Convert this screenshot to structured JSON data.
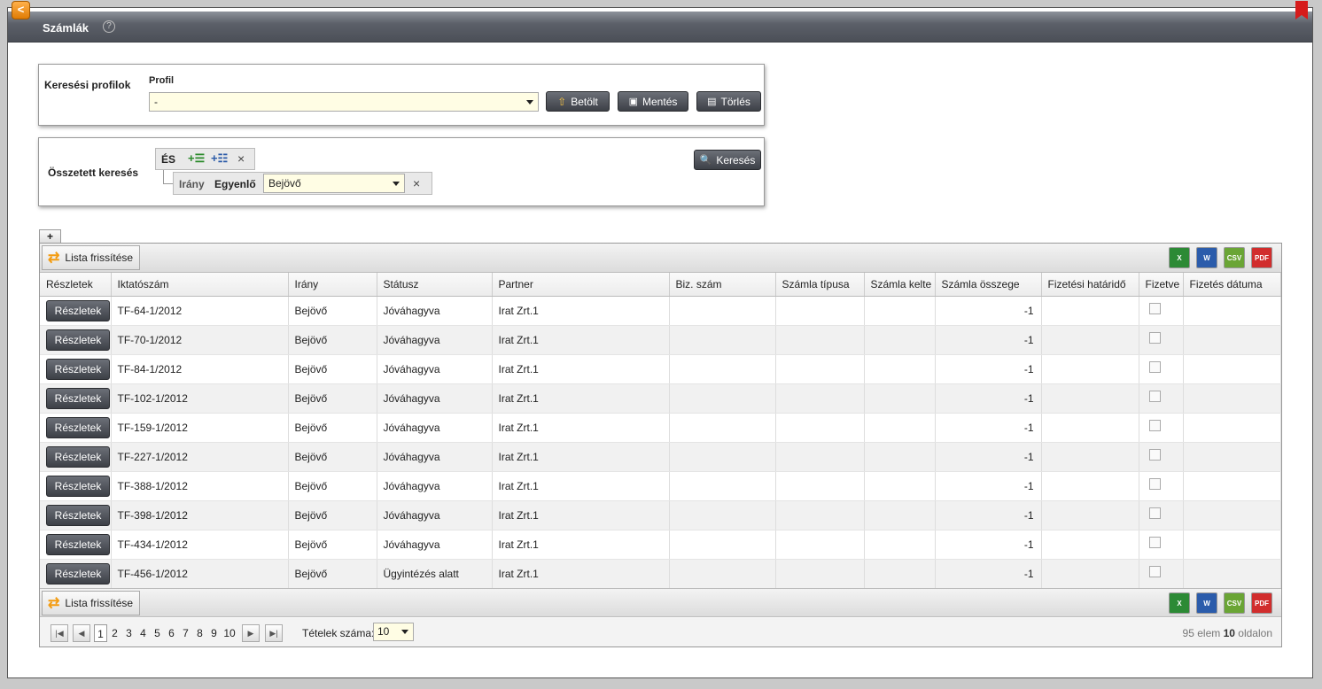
{
  "window": {
    "title": "Számlák",
    "help_icon": "?",
    "back_icon": "<"
  },
  "profiles": {
    "section_label": "Keresési profilok",
    "profile_label": "Profil",
    "profile_value": "-",
    "load_label": "Betölt",
    "save_label": "Mentés",
    "delete_label": "Törlés"
  },
  "complex_search": {
    "section_label": "Összetett keresés",
    "and_label": "ÉS",
    "remove_icon": "×",
    "field_label": "Irány",
    "operator_label": "Egyenlő",
    "value": "Bejövő",
    "search_label": "Keresés"
  },
  "add_tab": "+",
  "toolbar": {
    "refresh_label": "Lista frissítése",
    "export_excel": "X",
    "export_word": "W",
    "export_csv": "CSV",
    "export_pdf": "PDF"
  },
  "table": {
    "columns": [
      "Részletek",
      "Iktatószám",
      "Irány",
      "Státusz",
      "Partner",
      "Biz. szám",
      "Számla típusa",
      "Számla kelte",
      "Számla összege",
      "Fizetési határidő",
      "Fizetve",
      "Fizetés dátuma"
    ],
    "details_label": "Részletek",
    "rows": [
      {
        "id": "TF-64-1/2012",
        "dir": "Bejövő",
        "status": "Jóváhagyva",
        "partner": "Irat Zrt.1",
        "amount": "-1"
      },
      {
        "id": "TF-70-1/2012",
        "dir": "Bejövő",
        "status": "Jóváhagyva",
        "partner": "Irat Zrt.1",
        "amount": "-1"
      },
      {
        "id": "TF-84-1/2012",
        "dir": "Bejövő",
        "status": "Jóváhagyva",
        "partner": "Irat Zrt.1",
        "amount": "-1"
      },
      {
        "id": "TF-102-1/2012",
        "dir": "Bejövő",
        "status": "Jóváhagyva",
        "partner": "Irat Zrt.1",
        "amount": "-1"
      },
      {
        "id": "TF-159-1/2012",
        "dir": "Bejövő",
        "status": "Jóváhagyva",
        "partner": "Irat Zrt.1",
        "amount": "-1"
      },
      {
        "id": "TF-227-1/2012",
        "dir": "Bejövő",
        "status": "Jóváhagyva",
        "partner": "Irat Zrt.1",
        "amount": "-1"
      },
      {
        "id": "TF-388-1/2012",
        "dir": "Bejövő",
        "status": "Jóváhagyva",
        "partner": "Irat Zrt.1",
        "amount": "-1"
      },
      {
        "id": "TF-398-1/2012",
        "dir": "Bejövő",
        "status": "Jóváhagyva",
        "partner": "Irat Zrt.1",
        "amount": "-1"
      },
      {
        "id": "TF-434-1/2012",
        "dir": "Bejövő",
        "status": "Jóváhagyva",
        "partner": "Irat Zrt.1",
        "amount": "-1"
      },
      {
        "id": "TF-456-1/2012",
        "dir": "Bejövő",
        "status": "Ügyintézés alatt",
        "partner": "Irat Zrt.1",
        "amount": "-1"
      }
    ]
  },
  "pager": {
    "pages": [
      "1",
      "2",
      "3",
      "4",
      "5",
      "6",
      "7",
      "8",
      "9",
      "10"
    ],
    "current": "1",
    "items_label": "Tételek száma:",
    "items_value": "10",
    "total_count": "95",
    "total_mid": "elem",
    "total_pages": "10",
    "total_suffix": "oldalon"
  },
  "colors": {
    "accent": "#e07c05",
    "header_dark": "#4b4f57",
    "input_bg": "#fffde4"
  }
}
